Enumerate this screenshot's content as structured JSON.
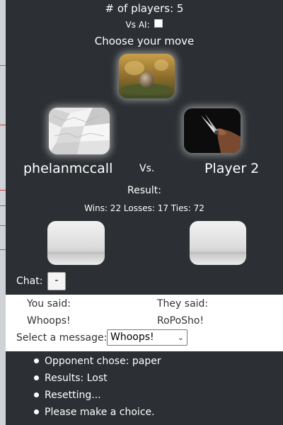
{
  "header": {
    "players_label": "# of players: 5",
    "vs_ai_label": "Vs AI:",
    "vs_ai_checked": false,
    "choose_prompt": "Choose your move"
  },
  "moves": [
    {
      "name": "rock",
      "icon": "rock-image"
    },
    {
      "name": "paper",
      "icon": "crumpled-paper-image"
    },
    {
      "name": "scissors",
      "icon": "scissors-image"
    }
  ],
  "players": {
    "left": "phelanmccall",
    "vs": "Vs.",
    "right": "Player 2"
  },
  "result": {
    "label": "Result:",
    "stats": "Wins: 22 Losses: 17 Ties: 72"
  },
  "chat": {
    "label": "Chat:",
    "toggle_label": "-",
    "you_said_label": "You said:",
    "they_said_label": "They said:",
    "you_said_msg": "Whoops!",
    "they_said_msg": "RoPoSho!",
    "select_label": "Select a message:",
    "selected_message": "Whoops!"
  },
  "log": [
    "Opponent chose: paper",
    "Results: Lost",
    "Resetting...",
    "Please make a choice."
  ],
  "colors": {
    "background": "#2c2f33",
    "panel": "#ffffff"
  }
}
